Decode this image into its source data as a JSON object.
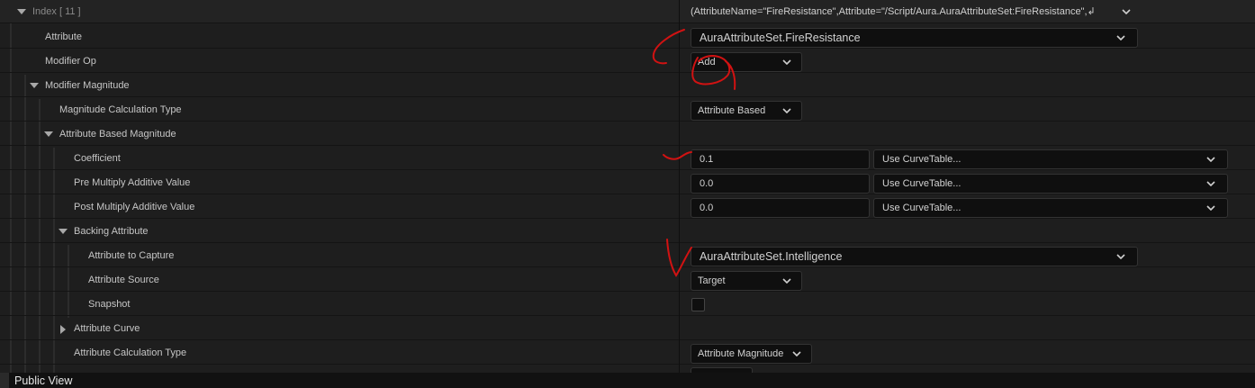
{
  "header": {
    "label": "Index [ 11 ]",
    "summary": "(AttributeName=\"FireResistance\",Attribute=\"/Script/Aura.AuraAttributeSet:FireResistance\",↲"
  },
  "rows": {
    "attribute": {
      "label": "Attribute",
      "value": "AuraAttributeSet.FireResistance"
    },
    "modifier_op": {
      "label": "Modifier Op",
      "value": "Add"
    },
    "modifier_magnitude": {
      "label": "Modifier Magnitude"
    },
    "magnitude_calc_type": {
      "label": "Magnitude Calculation Type",
      "value": "Attribute Based"
    },
    "attribute_based_magnitude": {
      "label": "Attribute Based Magnitude"
    },
    "coefficient": {
      "label": "Coefficient",
      "value": "0.1",
      "curve": "Use CurveTable..."
    },
    "pre_multiply": {
      "label": "Pre Multiply Additive Value",
      "value": "0.0",
      "curve": "Use CurveTable..."
    },
    "post_multiply": {
      "label": "Post Multiply Additive Value",
      "value": "0.0",
      "curve": "Use CurveTable..."
    },
    "backing_attribute": {
      "label": "Backing Attribute"
    },
    "attribute_to_capture": {
      "label": "Attribute to Capture",
      "value": "AuraAttributeSet.Intelligence"
    },
    "attribute_source": {
      "label": "Attribute Source",
      "value": "Target"
    },
    "snapshot": {
      "label": "Snapshot",
      "checked": false
    },
    "attribute_curve": {
      "label": "Attribute Curve"
    },
    "attribute_calc_type": {
      "label": "Attribute Calculation Type",
      "value": "Attribute Magnitude"
    }
  },
  "footer": {
    "label": "Public View"
  },
  "colors": {
    "background": "#1e1e1e",
    "field": "#0f0f0f",
    "text": "#c6c6c6",
    "annotation": "#d11212"
  },
  "icons": [
    "expand-arrow-icon",
    "collapse-arrow-icon",
    "chevron-down-icon"
  ]
}
